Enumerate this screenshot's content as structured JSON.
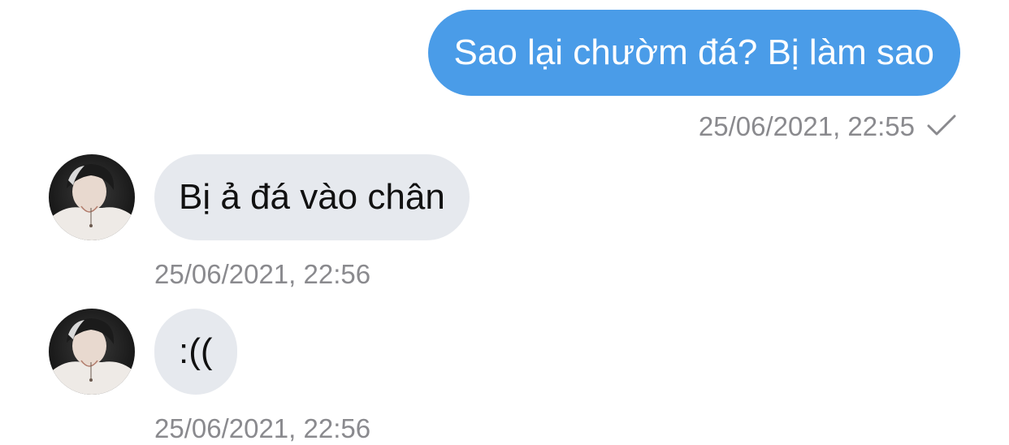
{
  "messages": [
    {
      "direction": "outgoing",
      "text": "Sao lại chườm đá? Bị làm sao",
      "timestamp": "25/06/2021, 22:55",
      "status_icon": "checkmark-icon"
    },
    {
      "direction": "incoming",
      "text": "Bị ả đá vào chân",
      "timestamp": "25/06/2021, 22:56",
      "avatar_icon": "avatar"
    },
    {
      "direction": "incoming",
      "text": ":((",
      "timestamp": "25/06/2021, 22:56",
      "avatar_icon": "avatar"
    }
  ],
  "colors": {
    "outgoing_bubble": "#4A9CE8",
    "incoming_bubble": "#E6E9EE",
    "timestamp": "#8A8A8E"
  }
}
